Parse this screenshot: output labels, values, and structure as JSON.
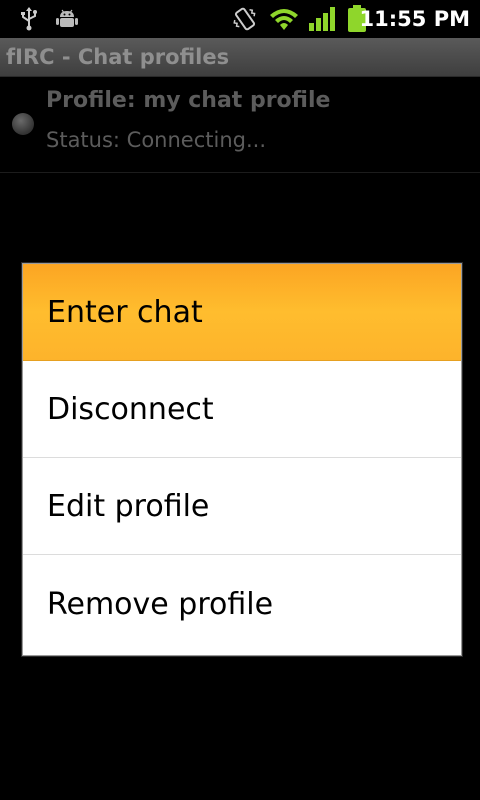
{
  "status_bar": {
    "icons": [
      "usb-icon",
      "android-debug-icon",
      "vibrate-icon",
      "wifi-icon",
      "signal-icon",
      "battery-icon"
    ],
    "time": "11:55 PM"
  },
  "app": {
    "title": "fIRC - Chat profiles"
  },
  "profiles": [
    {
      "name": "Profile: my chat profile",
      "status": "Status: Connecting..."
    }
  ],
  "context_menu": {
    "items": [
      {
        "label": "Enter chat",
        "selected": true
      },
      {
        "label": "Disconnect",
        "selected": false
      },
      {
        "label": "Edit profile",
        "selected": false
      },
      {
        "label": "Remove profile",
        "selected": false
      }
    ]
  },
  "colors": {
    "highlight": "#ffbd2e",
    "wifi_green": "#8fd62b",
    "battery_green": "#8fd62b"
  }
}
